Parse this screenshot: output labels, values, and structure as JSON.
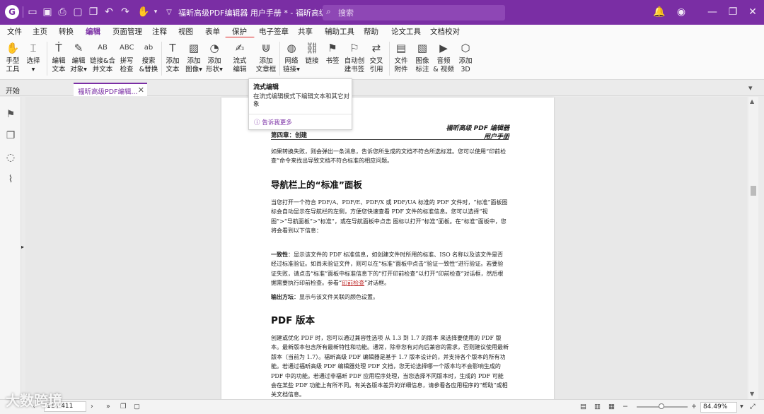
{
  "titlebar": {
    "title": "福昕高级PDF编辑器 用户手册 * - 福昕高级PDF编...",
    "search_placeholder": "搜索"
  },
  "menu": [
    "文件",
    "主页",
    "转换",
    "编辑",
    "页面管理",
    "注释",
    "视图",
    "表单",
    "保护",
    "电子签章",
    "共享",
    "辅助工具",
    "帮助",
    "论文工具",
    "文档校对"
  ],
  "menu_active": "编辑",
  "ribbon": {
    "hand": "手型\n工具",
    "select": "选择\n▾",
    "edit_text": "编辑\n文本",
    "edit_object": "编辑\n对象▾",
    "link_merge": "链接&合\n并文本",
    "spell": "拼写\n检查",
    "find_replace": "搜索\n&替换",
    "add_text": "添加\n文本",
    "add_image": "添加\n图像▾",
    "add_shape": "添加\n形状▾",
    "flow_edit": "流式\n编辑",
    "add_textbox": "添加\n文章框",
    "web_link": "网络\n链接▾",
    "link": "链接",
    "bookmark": "书签",
    "auto_bookmark": "自动创\n建书签",
    "cross_ref": "交叉\n引用",
    "file_attach": "文件\n附件",
    "image_mark": "图像\n标注",
    "audio_video": "音频\n& 视频",
    "add_3d": "添加\n3D"
  },
  "tabs": {
    "start": "开始",
    "doc": "福昕高级PDF编辑..."
  },
  "tooltip": {
    "title": "流式编辑",
    "desc": "在流式编辑模式下编辑文本和其它对象",
    "more": "告诉我更多"
  },
  "page": {
    "hdr1": "福昕高级 PDF 编辑器",
    "hdr2": "用户手册",
    "chapter": "第四章：创建",
    "p1": "如果转换失败，则会弹出一条消息，告诉您所生成的文档不符合所选标准。您可以使用“印前检查”命令来找出导致文档不符合标准的相应问题。",
    "h1": "导航栏上的“标准”面板",
    "p2": "当您打开一个符合 PDF/A、PDF/E、PDF/X 或 PDF/UA 标准的 PDF 文件时，“标准”面板图标会自动显示在导航栏的左侧，方便您快速查看 PDF 文件的标准信息。您可以选择“视图”>“导航面板”>“标准”，或在导航面板中点击 图标以打开“标准”面板。在“标准”面板中，您将会看到以下信息：",
    "p3_bold": "一致性",
    "p3": "：显示该文件的 PDF 标准信息，如创建文件时所用的标准、ISO 名称以及该文件是否经过标准验证。如尚未验证文件，则可以在“标准”面板中点击“验证一致性”进行验证。若要验证失败，请点击“标准”面板中标准信息下的“打开印前检查”以打开“印前检查”对话框，然后根据需要执行印前检查。参看“",
    "p3_link": "印前检查",
    "p3_end": "”对话框。",
    "p4_bold": "输出方坛",
    "p4": "：显示与该文件关联的颜色设置。",
    "h2": "PDF 版本",
    "p5": "创建或优化 PDF 时，您可以通过兼容性选项 从 1.3 到 1.7 的版本 来选择要使用的 PDF 版本。最新版本包含所有最新特性和功能。通常，除非您有对向后兼容的需求，否则建议使用最新版本（当前为 1.7）。福昕高级 PDF 编辑器是基于 1.7 版本设计的，并支持各个版本的所有功能。若通过福昕高级 PDF 编辑器处理 PDF 文档，您无论选择哪一个版本均不会影响生成的 PDF 中的功能。若通过非福昕 PDF 应用程序处理，当您选择不同版本时，生成的 PDF 可能会在某些 PDF 功能上有所不同。有关各版本差异的详细信息，请参看各应用程序的“帮助”或相关文档信息。"
  },
  "status": {
    "page": "11 / 411",
    "zoom": "84.49%"
  },
  "watermark": "大数跨境"
}
